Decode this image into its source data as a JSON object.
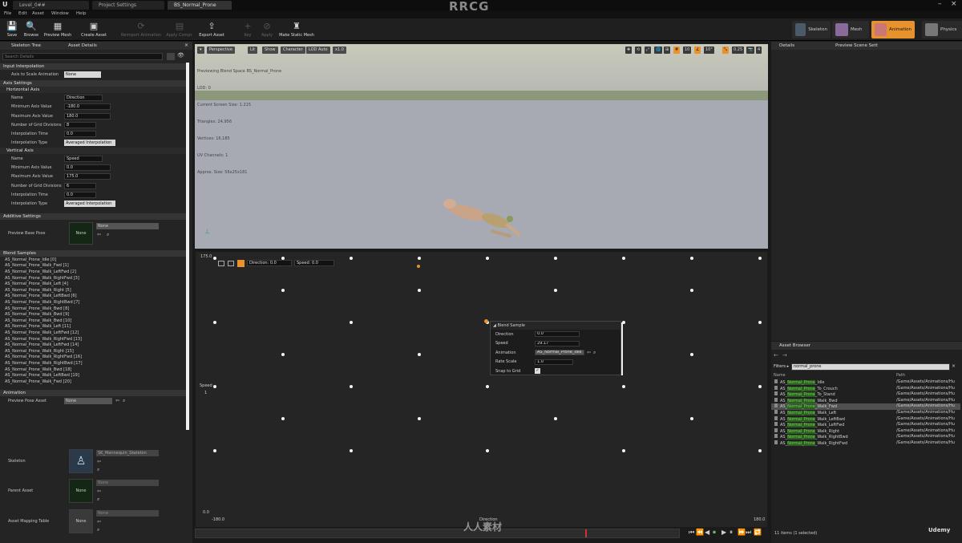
{
  "window": {
    "title": "RRCG",
    "minimize": "–",
    "close": "×"
  },
  "tabs": [
    "Level_0##",
    "Project Settings",
    "BS_Normal_Prone"
  ],
  "menu": [
    "File",
    "Edit",
    "Asset",
    "Window",
    "Help"
  ],
  "toolbar": [
    {
      "label": "Save",
      "icon": "save-icon",
      "glyph": "💾",
      "enabled": true
    },
    {
      "label": "Browse",
      "icon": "browse-icon",
      "glyph": "🔍",
      "enabled": true
    },
    {
      "label": "Preview Mesh",
      "icon": "preview-mesh-icon",
      "glyph": "▦",
      "enabled": true
    },
    {
      "label": "Create Asset",
      "icon": "create-asset-icon",
      "glyph": "▣",
      "enabled": true
    },
    {
      "label": "Reimport Animation",
      "icon": "reimport-icon",
      "glyph": "⟳",
      "enabled": false
    },
    {
      "label": "Apply Compr.",
      "icon": "compress-icon",
      "glyph": "▤",
      "enabled": false
    },
    {
      "label": "Export Asset",
      "icon": "export-icon",
      "glyph": "⇪",
      "enabled": true
    },
    {
      "label": "Key",
      "icon": "key-icon",
      "glyph": "+",
      "enabled": false
    },
    {
      "label": "Apply",
      "icon": "apply-icon",
      "glyph": "⊘",
      "enabled": false
    },
    {
      "label": "Make Static Mesh",
      "icon": "static-mesh-icon",
      "glyph": "♜",
      "enabled": true
    }
  ],
  "modes": [
    "Skeleton",
    "Mesh",
    "Animation",
    "Physics"
  ],
  "left_tabs": [
    "Skeleton Tree",
    "Asset Details"
  ],
  "search_placeholder": "Search Details",
  "input_interpolation": {
    "section": "Input Interpolation",
    "label": "Axis to Scale Animation",
    "value": "None"
  },
  "axis_settings": {
    "section": "Axis Settings",
    "horizontal": {
      "title": "Horizontal Axis",
      "name_label": "Name",
      "name": "Direction",
      "min_label": "Minimum Axis Value",
      "min": "-180.0",
      "max_label": "Maximum Axis Value",
      "max": "180.0",
      "div_label": "Number of Grid Divisions",
      "div": "8",
      "time_label": "Interpolation Time",
      "time": "0.0",
      "type_label": "Interpolation Type",
      "type": "Averaged Interpolation"
    },
    "vertical": {
      "title": "Vertical Axis",
      "name_label": "Name",
      "name": "Speed",
      "min_label": "Minimum Axis Value",
      "min": "0.0",
      "max_label": "Maximum Axis Value",
      "max": "175.0",
      "div_label": "Number of Grid Divisions",
      "div": "6",
      "time_label": "Interpolation Time",
      "time": "0.0",
      "type_label": "Interpolation Type",
      "type": "Averaged Interpolation"
    }
  },
  "additive": {
    "section": "Additive Settings",
    "label": "Preview Base Pose",
    "thumb": "None",
    "value": "None"
  },
  "blend_samples": {
    "section": "Blend Samples",
    "items": [
      "AS_Normal_Prone_Idle [0]",
      "AS_Normal_Prone_Walk_Fwd [1]",
      "AS_Normal_Prone_Walk_LeftFwd [2]",
      "AS_Normal_Prone_Walk_RightFwd [3]",
      "AS_Normal_Prone_Walk_Left [4]",
      "AS_Normal_Prone_Walk_Right [5]",
      "AS_Normal_Prone_Walk_LeftBwd [6]",
      "AS_Normal_Prone_Walk_RightBwd [7]",
      "AS_Normal_Prone_Walk_Bwd [8]",
      "AS_Normal_Prone_Walk_Bwd [9]",
      "AS_Normal_Prone_Walk_Bwd [10]",
      "AS_Normal_Prone_Walk_Left [11]",
      "AS_Normal_Prone_Walk_LeftFwd [12]",
      "AS_Normal_Prone_Walk_RightFwd [13]",
      "AS_Normal_Prone_Walk_LeftFwd [14]",
      "AS_Normal_Prone_Walk_Right [15]",
      "AS_Normal_Prone_Walk_RightFwd [16]",
      "AS_Normal_Prone_Walk_RightBwd [17]",
      "AS_Normal_Prone_Walk_Bwd [18]",
      "AS_Normal_Prone_Walk_LeftBwd [19]",
      "AS_Normal_Prone_Walk_Fwd [20]"
    ]
  },
  "animation": {
    "section": "Animation",
    "preview_label": "Preview Pose Asset",
    "preview_value": "None",
    "skeleton_label": "Skeleton",
    "skeleton_value": "SK_Mannequin_Skeleton",
    "parent_label": "Parent Asset",
    "parent_thumb": "None",
    "parent_value": "None",
    "mapping_label": "Asset Mapping Table",
    "mapping_thumb": "None",
    "mapping_value": "None"
  },
  "viewport": {
    "buttons": [
      "Perspective",
      "Lit",
      "Show",
      "Character",
      "LOD Auto",
      "x1.0"
    ],
    "stats": [
      "Previewing Blend Space BS_Normal_Prone",
      "LOD: 0",
      "Current Screen Size: 1.215",
      "Triangles: 24,956",
      "Vertices: 16,185",
      "UV Channels: 1",
      "Approx. Size: 56x25x181"
    ],
    "right_controls": [
      "10",
      "10°",
      "0.25",
      "4"
    ]
  },
  "blend_space": {
    "filters": [
      "Direction: 0.0",
      "Speed: 0.0"
    ],
    "y_max": "175.0",
    "y_min": "0.0",
    "y_label": "Speed",
    "y_mid": "1",
    "x_min": "-180.0",
    "x_label": "Direction",
    "x_max": "180.0"
  },
  "sample_popup": {
    "title": "Blend Sample",
    "dir_label": "Direction",
    "dir": "0.0",
    "speed_label": "Speed",
    "speed": "29.17",
    "anim_label": "Animation",
    "anim": "AS_Normal_Prone_Idle",
    "rate_label": "Rate Scale",
    "rate": "1.0",
    "snap_label": "Snap to Grid",
    "snap": "✓"
  },
  "timeline": {
    "controls": [
      "⏮",
      "⏪",
      "◀",
      "⏺",
      "▶",
      "⏸",
      "⏩",
      "⏭",
      "🔁",
      "⏺"
    ]
  },
  "right_tabs": [
    "Details",
    "Preview Scene Sett"
  ],
  "asset_browser": {
    "title": "Asset Browser",
    "filter": "Filters ▸",
    "search": "normal_prone",
    "col_name": "Name",
    "col_path": "Path",
    "rows": [
      {
        "pre": "AS_",
        "hl": "Normal_Prone",
        "post": "_Idle",
        "path": "/Game/Assets/Animations/Hu"
      },
      {
        "pre": "AS_",
        "hl": "Normal_Prone",
        "post": "_To_Crouch",
        "path": "/Game/Assets/Animations/Hu"
      },
      {
        "pre": "AS_",
        "hl": "Normal_Prone",
        "post": "_To_Stand",
        "path": "/Game/Assets/Animations/Hu"
      },
      {
        "pre": "AS_",
        "hl": "Normal_Prone",
        "post": "_Walk_Bwd",
        "path": "/Game/Assets/Animations/Hu"
      },
      {
        "pre": "AS_",
        "hl": "Normal_Prone",
        "post": "_Walk_Fwd",
        "path": "/Game/Assets/Animations/Hu"
      },
      {
        "pre": "AS_",
        "hl": "Normal_Prone",
        "post": "_Walk_Left",
        "path": "/Game/Assets/Animations/Hu"
      },
      {
        "pre": "AS_",
        "hl": "Normal_Prone",
        "post": "_Walk_LeftBwd",
        "path": "/Game/Assets/Animations/Hu"
      },
      {
        "pre": "AS_",
        "hl": "Normal_Prone",
        "post": "_Walk_LeftFwd",
        "path": "/Game/Assets/Animations/Hu"
      },
      {
        "pre": "AS_",
        "hl": "Normal_Prone",
        "post": "_Walk_Right",
        "path": "/Game/Assets/Animations/Hu"
      },
      {
        "pre": "AS_",
        "hl": "Normal_Prone",
        "post": "_Walk_RightBwd",
        "path": "/Game/Assets/Animations/Hu"
      },
      {
        "pre": "AS_",
        "hl": "Normal_Prone",
        "post": "_Walk_RightFwd",
        "path": "/Game/Assets/Animations/Hu"
      }
    ],
    "count": "11 items (1 selected)"
  },
  "watermark": {
    "logo": "人人素材",
    "corner": "Udemy"
  },
  "colors": {
    "accent": "#e8922e",
    "highlight": "#6cd84c"
  }
}
